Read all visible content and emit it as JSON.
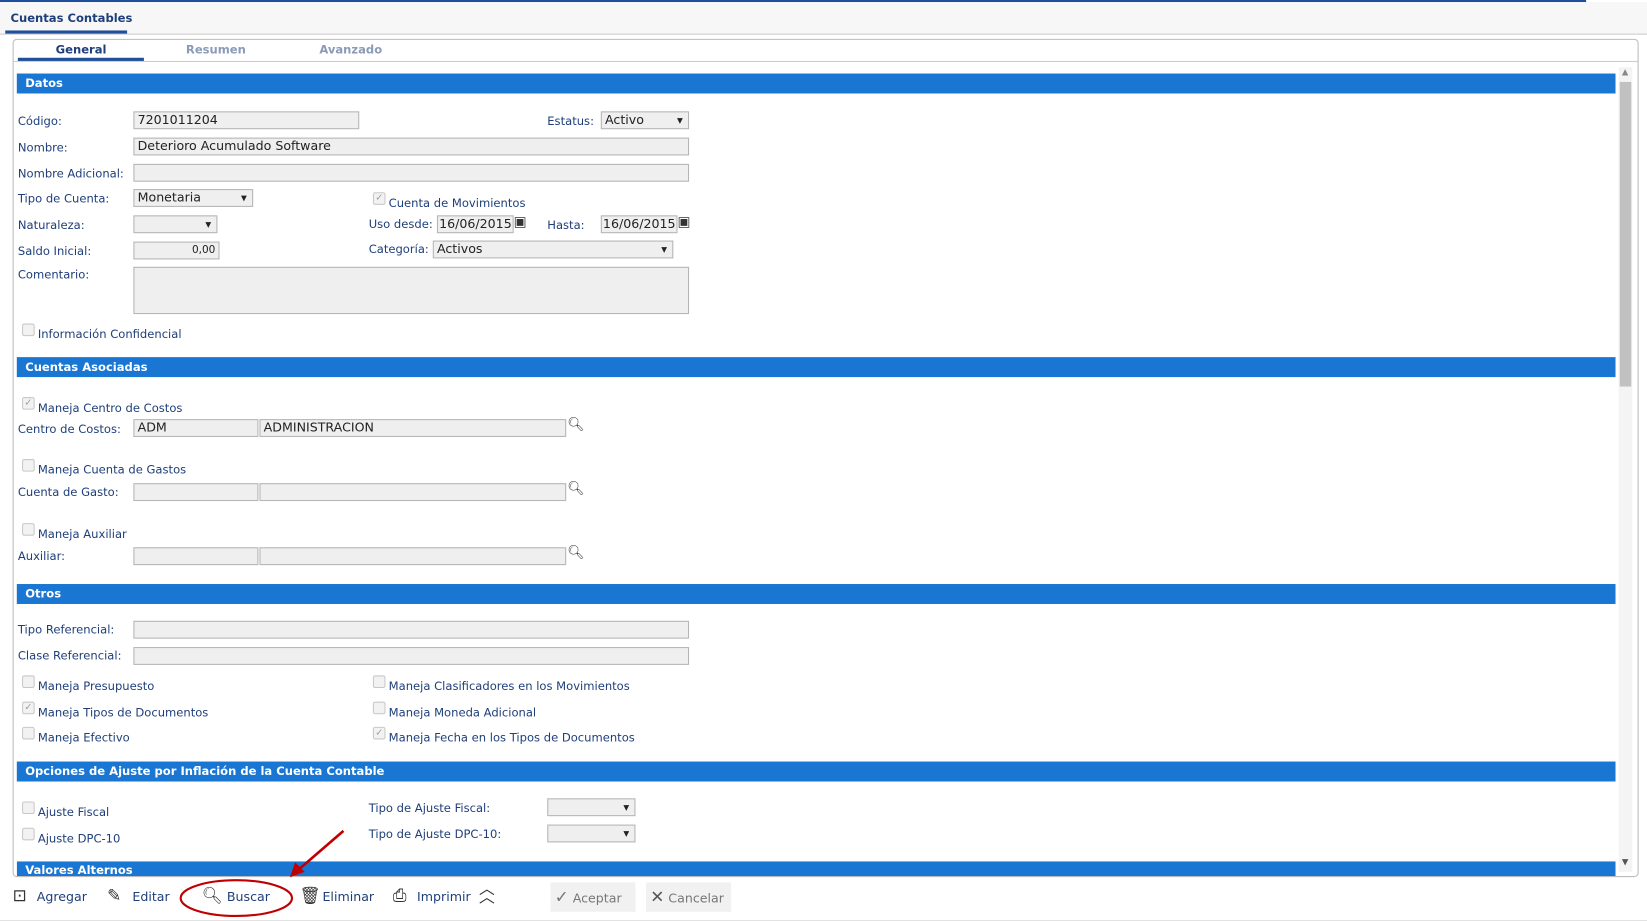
{
  "window": {
    "tab": "Cuentas Contables"
  },
  "tabs": [
    {
      "label": "General",
      "active": true
    },
    {
      "label": "Resumen"
    },
    {
      "label": "Avanzado"
    }
  ],
  "sections": {
    "datos": "Datos",
    "asociadas": "Cuentas Asociadas",
    "otros": "Otros",
    "ajuste": "Opciones de Ajuste por Inflación de la Cuenta Contable",
    "alternos": "Valores Alternos"
  },
  "datos": {
    "codigo_label": "Código:",
    "codigo": "7201011204",
    "estatus_label": "Estatus:",
    "estatus": "Activo",
    "nombre_label": "Nombre:",
    "nombre": "Deterioro Acumulado Software",
    "nombre_adicional_label": "Nombre Adicional:",
    "nombre_adicional": "",
    "tipo_label": "Tipo de Cuenta:",
    "tipo": "Monetaria",
    "movimientos_label": "Cuenta de Movimientos",
    "movimientos_checked": true,
    "naturaleza_label": "Naturaleza:",
    "naturaleza": "",
    "uso_desde_label": "Uso desde:",
    "uso_desde": "16/06/2015",
    "hasta_label": "Hasta:",
    "hasta": "16/06/2015",
    "saldo_label": "Saldo Inicial:",
    "saldo": "0,00",
    "categoria_label": "Categoría:",
    "categoria": "Activos",
    "comentario_label": "Comentario:",
    "comentario": "",
    "confidencial_label": "Información Confidencial",
    "confidencial_checked": false
  },
  "asociadas": {
    "centro_check_label": "Maneja Centro de Costos",
    "centro_checked": true,
    "centro_label": "Centro de Costos:",
    "centro_code": "ADM",
    "centro_name": "ADMINISTRACION",
    "gastos_check_label": "Maneja Cuenta de Gastos",
    "gastos_checked": false,
    "gasto_label": "Cuenta de Gasto:",
    "gasto_code": "",
    "gasto_name": "",
    "aux_check_label": "Maneja Auxiliar",
    "aux_checked": false,
    "aux_label": "Auxiliar:",
    "aux_code": "",
    "aux_name": ""
  },
  "otros": {
    "tipo_ref_label": "Tipo Referencial:",
    "tipo_ref": "",
    "clase_ref_label": "Clase Referencial:",
    "clase_ref": "",
    "checks": [
      {
        "label": "Maneja Presupuesto",
        "checked": false
      },
      {
        "label": "Maneja Clasificadores en los Movimientos",
        "checked": false
      },
      {
        "label": "Maneja Tipos de Documentos",
        "checked": true
      },
      {
        "label": "Maneja Moneda Adicional",
        "checked": false
      },
      {
        "label": "Maneja Efectivo",
        "checked": false
      },
      {
        "label": "Maneja Fecha en los Tipos de Documentos",
        "checked": true
      }
    ]
  },
  "ajuste": {
    "fiscal_label": "Ajuste Fiscal",
    "dpc_label": "Ajuste DPC-10",
    "tipo_fiscal_label": "Tipo de Ajuste Fiscal:",
    "tipo_fiscal": "",
    "tipo_dpc_label": "Tipo de Ajuste DPC-10:",
    "tipo_dpc": ""
  },
  "toolbar": {
    "agregar": "Agregar",
    "editar": "Editar",
    "buscar": "Buscar",
    "eliminar": "Eliminar",
    "imprimir": "Imprimir",
    "aceptar": "Aceptar",
    "cancelar": "Cancelar"
  },
  "colors": {
    "section": "#1976d2",
    "label": "#1f3f7a",
    "annotation": "#c00000"
  }
}
